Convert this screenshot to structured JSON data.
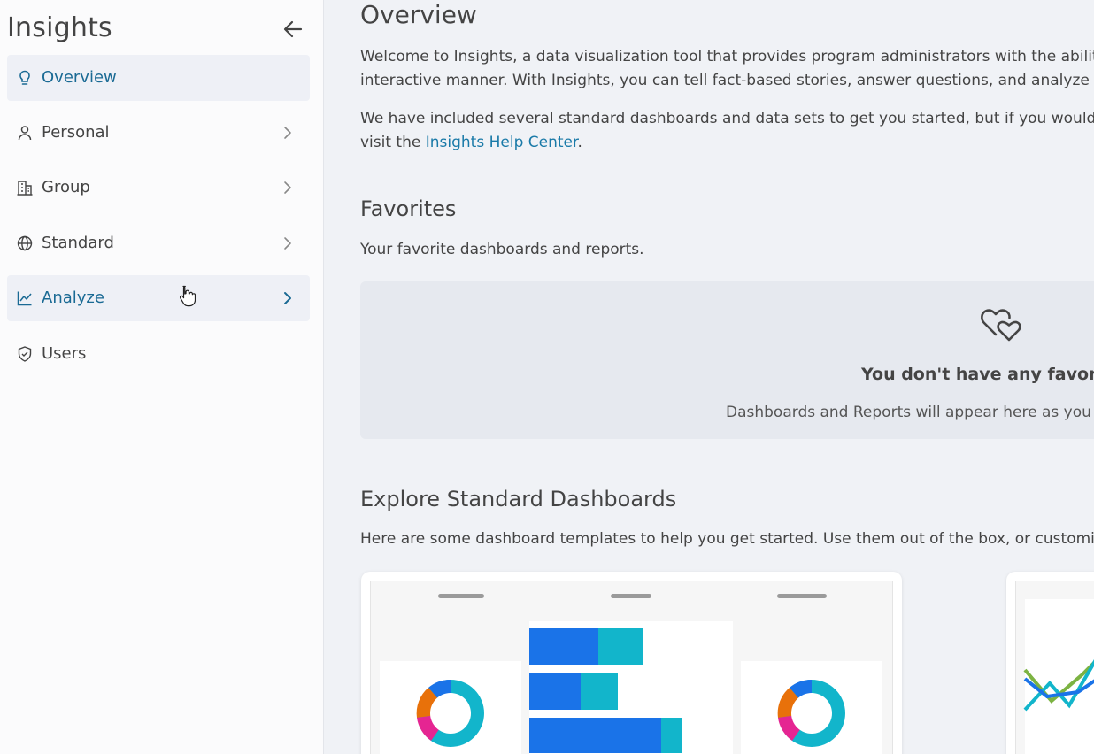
{
  "sidebar": {
    "title": "Insights",
    "back_icon": "arrow-left-icon",
    "items": [
      {
        "label": "Overview",
        "icon": "lightbulb-icon",
        "state": "active",
        "chevron": false
      },
      {
        "label": "Personal",
        "icon": "person-icon",
        "state": "normal",
        "chevron": true
      },
      {
        "label": "Group",
        "icon": "building-icon",
        "state": "normal",
        "chevron": true
      },
      {
        "label": "Standard",
        "icon": "globe-icon",
        "state": "normal",
        "chevron": true
      },
      {
        "label": "Analyze",
        "icon": "line-chart-icon",
        "state": "hover",
        "chevron": true
      },
      {
        "label": "Users",
        "icon": "shield-icon",
        "state": "normal",
        "chevron": false
      }
    ]
  },
  "main": {
    "title": "Overview",
    "intro_line1": "Welcome to Insights, a data visualization tool that provides program administrators with the ability to",
    "intro_line2": "interactive manner. With Insights, you can tell fact-based stories, answer questions, and analyze the tr",
    "included_line1": "We have included several standard dashboards and data sets to get you started, but if you would like t",
    "included_line2_prefix": "visit the ",
    "help_link": "Insights Help Center",
    "included_line2_suffix": ".",
    "favorites": {
      "heading": "Favorites",
      "description": "Your favorite dashboards and reports.",
      "empty_icon": "hearts-icon",
      "empty_title": "You don't have any favorite",
      "empty_subtitle": "Dashboards and Reports will appear here as you ac"
    },
    "explore": {
      "heading": "Explore Standard Dashboards",
      "description": "Here are some dashboard templates to help you get started. Use them out of the box, or customize th"
    }
  },
  "colors": {
    "accent": "#1a6a94",
    "link": "#1a7aa8",
    "blue": "#1a73e8",
    "teal": "#12b5cb",
    "orange": "#e8710a",
    "magenta": "#e52592",
    "green": "#7cb342"
  }
}
